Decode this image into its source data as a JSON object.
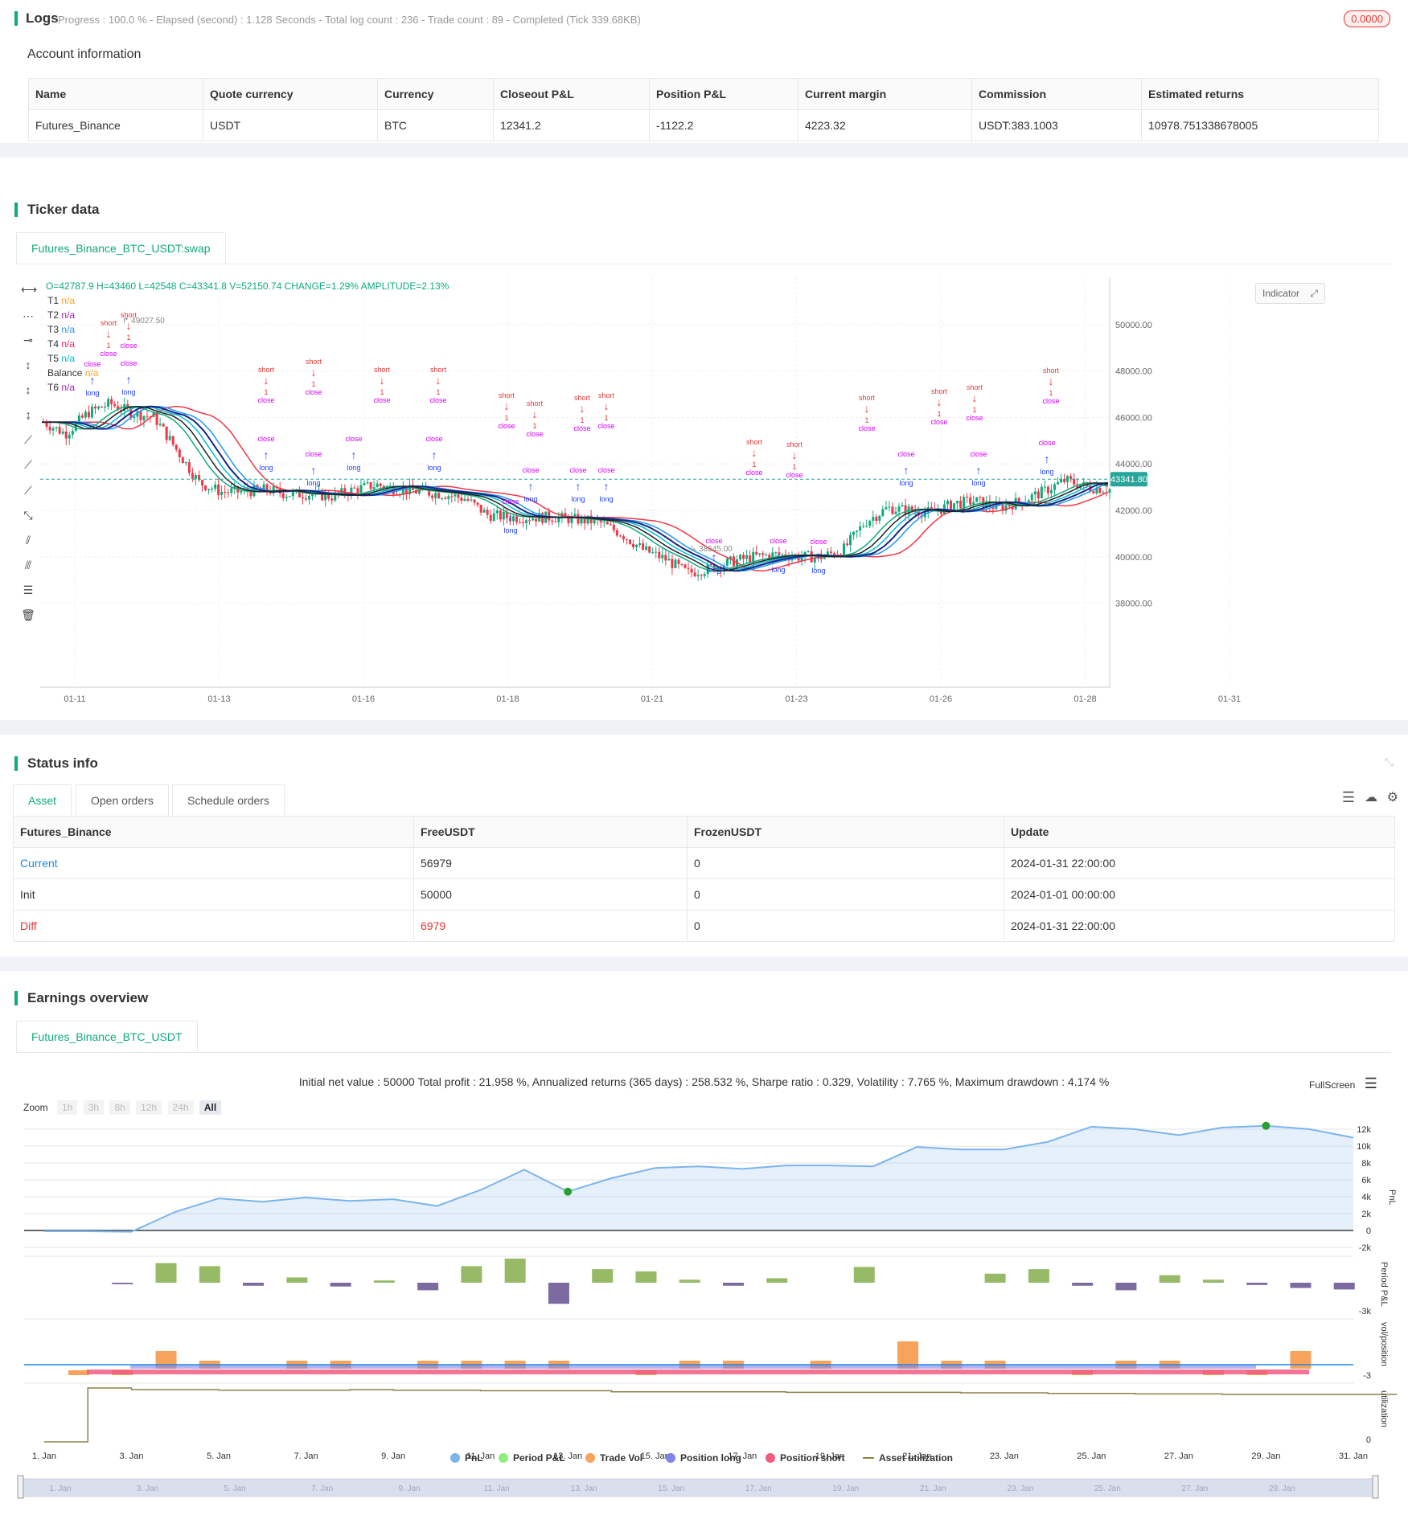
{
  "logs": {
    "title": "Logs",
    "status": "Progress : 100.0 % - Elapsed (second) : 1.128  Seconds - Total log count : 236 - Trade count : 89 - Completed (Tick 339.68KB)",
    "badge": "0.0000"
  },
  "account": {
    "title": "Account information",
    "headers": [
      "Name",
      "Quote currency",
      "Currency",
      "Closeout P&L",
      "Position P&L",
      "Current margin",
      "Commission",
      "Estimated returns"
    ],
    "row": [
      "Futures_Binance",
      "USDT",
      "BTC",
      "12341.2",
      "-1122.2",
      "4223.32",
      "USDT:383.1003",
      "10978.751338678005"
    ]
  },
  "ticker": {
    "title": "Ticker data",
    "tab": "Futures_Binance_BTC_USDT:swap",
    "ohlc": "O=42787.9 H=43460 L=42548 C=43341.8 V=52150.74 CHANGE=1.29% AMPLITUDE=2.13%",
    "indicator_btn": "Indicator",
    "legend": [
      {
        "name": "T1",
        "value": "n/a",
        "color": "#f5a623"
      },
      {
        "name": "T2",
        "value": "n/a",
        "color": "#9c27b0"
      },
      {
        "name": "T3",
        "value": "n/a",
        "color": "#2196f3"
      },
      {
        "name": "T4",
        "value": "n/a",
        "color": "#e91e63"
      },
      {
        "name": "T5",
        "value": "n/a",
        "color": "#00bcd4"
      },
      {
        "name": "Balance",
        "value": "n/a",
        "color": "#f5a623"
      },
      {
        "name": "T6",
        "value": "n/a",
        "color": "#9c27b0"
      }
    ],
    "price_label": "43341.80",
    "high_label": "49027.50",
    "low_label": "38545.00",
    "y_ticks": [
      "50000.00",
      "48000.00",
      "46000.00",
      "44000.00",
      "42000.00",
      "40000.00",
      "38000.00"
    ],
    "x_ticks": [
      "01-11",
      "01-13",
      "01-16",
      "01-18",
      "01-21",
      "01-23",
      "01-26",
      "01-28",
      "01-31"
    ],
    "signal_words": {
      "long": "long",
      "short": "short",
      "close": "close",
      "Long": "Long",
      "Short": "Short",
      "one": "1"
    }
  },
  "status": {
    "title": "Status info",
    "tabs": [
      "Asset",
      "Open orders",
      "Schedule orders"
    ],
    "headers": [
      "Futures_Binance",
      "FreeUSDT",
      "FrozenUSDT",
      "Update"
    ],
    "rows": [
      [
        "Current",
        "56979",
        "0",
        "2024-01-31 22:00:00"
      ],
      [
        "Init",
        "50000",
        "0",
        "2024-01-01 00:00:00"
      ],
      [
        "Diff",
        "6979",
        "0",
        "2024-01-31 22:00:00"
      ]
    ]
  },
  "earnings": {
    "title": "Earnings overview",
    "tab": "Futures_Binance_BTC_USDT",
    "summary": "Initial net value : 50000 Total profit : 21.958 %, Annualized returns (365 days) : 258.532 %, Sharpe ratio : 0.329, Volatility : 7.765 %, Maximum drawdown : 4.174 %",
    "fullscreen": "FullScreen",
    "zoom_label": "Zoom",
    "zoom_buttons": [
      "1h",
      "3h",
      "8h",
      "12h",
      "24h",
      "All"
    ],
    "pnl_ticks": [
      "12k",
      "10k",
      "8k",
      "6k",
      "4k",
      "2k",
      "0",
      "-2k"
    ],
    "pnl_axis": "PnL",
    "period_axis": "Period P&L",
    "period_tick": "-3k",
    "vol_axis": "vol/position",
    "vol_tick": "-3",
    "util_axis": "utilization",
    "util_tick": "0",
    "x_ticks": [
      "1. Jan",
      "3. Jan",
      "5. Jan",
      "7. Jan",
      "9. Jan",
      "11. Jan",
      "13. Jan",
      "15. Jan",
      "17. Jan",
      "19. Jan",
      "21. Jan",
      "23. Jan",
      "25. Jan",
      "27. Jan",
      "29. Jan",
      "31. Jan"
    ],
    "legend": [
      {
        "name": "PnL",
        "color": "#7cb5ec"
      },
      {
        "name": "Period P&L",
        "color": "#90ed7d"
      },
      {
        "name": "Trade Vol",
        "color": "#f7a35c"
      },
      {
        "name": "Position long",
        "color": "#8085e9"
      },
      {
        "name": "Position short",
        "color": "#f15c80"
      },
      {
        "name": "Asset utilization",
        "color": "#8d8047"
      }
    ],
    "chart_data": {
      "type": "area",
      "pnl": [
        0,
        0,
        0,
        0,
        0,
        0,
        0,
        0,
        0,
        0,
        0,
        0,
        0,
        0,
        0,
        0,
        0,
        0,
        0,
        0,
        0,
        0,
        0,
        0,
        0,
        0,
        0,
        0,
        0,
        0,
        0,
        0
      ],
      "pnl_values": [
        -100,
        -100,
        -150,
        2200,
        3800,
        3400,
        3900,
        3500,
        3700,
        2900,
        4800,
        7200,
        4600,
        6200,
        7400,
        7600,
        7300,
        7700,
        7700,
        7600,
        9900,
        9600,
        9600,
        10500,
        12300,
        12000,
        11300,
        12200,
        12400,
        12000,
        11000
      ],
      "period_values": [
        0,
        -200,
        2600,
        2200,
        -400,
        700,
        -500,
        300,
        -1000,
        2200,
        3200,
        -2800,
        1800,
        1500,
        400,
        -400,
        600,
        0,
        2100,
        0,
        0,
        1200,
        1800,
        -400,
        -1000,
        1000,
        400,
        -300,
        -700,
        -900
      ],
      "trade_vol": [
        1,
        1,
        3,
        2,
        0,
        2,
        2,
        0,
        2,
        2,
        2,
        2,
        0,
        1,
        2,
        2,
        0,
        2,
        0,
        4,
        2,
        2,
        0,
        1,
        2,
        2,
        1,
        1,
        3,
        0
      ],
      "utilization": [
        0,
        1,
        0.97,
        0.97,
        0.96,
        0.96,
        0.96,
        0.97,
        0.96,
        0.96,
        0.95,
        0.95,
        0.95,
        0.93,
        0.93,
        0.93,
        0.93,
        0.92,
        0.92,
        0.92,
        0.92,
        0.91,
        0.91,
        0.9,
        0.9,
        0.89,
        0.89,
        0.88,
        0.88,
        0.88,
        0.88
      ]
    }
  }
}
